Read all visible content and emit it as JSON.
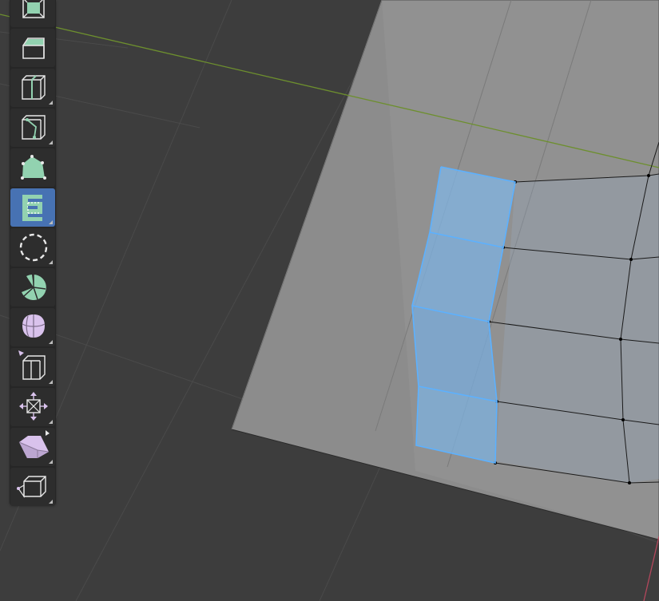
{
  "colors": {
    "background": "#3d3d3d",
    "mesh_plane": "#8e8e8e",
    "selection": "#7fb9ec",
    "selection_edge": "#5bb0ff",
    "axis_x": "#b3475c",
    "axis_y": "#6d8f2e",
    "toolbar": "#262626",
    "tool_active": "#4772b3",
    "mesh_icon": "#92d2b0",
    "transform_icon": "#d9c2ec"
  },
  "toolbar": {
    "tools": [
      {
        "name": "inset-faces",
        "icon": "inset-faces-icon",
        "active": false,
        "has_submenu": false
      },
      {
        "name": "bevel",
        "icon": "bevel-icon",
        "active": false,
        "has_submenu": false
      },
      {
        "name": "loop-cut",
        "icon": "loop-cut-icon",
        "active": false,
        "has_submenu": true
      },
      {
        "name": "knife",
        "icon": "knife-icon",
        "active": false,
        "has_submenu": true
      },
      {
        "name": "poly-build",
        "icon": "poly-build-icon",
        "active": false,
        "has_submenu": false
      },
      {
        "name": "extrude-region",
        "icon": "extrude-region-icon",
        "active": true,
        "has_submenu": true
      },
      {
        "name": "spin",
        "icon": "spin-icon",
        "active": false,
        "has_submenu": true
      },
      {
        "name": "smooth",
        "icon": "smooth-icon",
        "active": false,
        "has_submenu": false
      },
      {
        "name": "shrink-fatten",
        "icon": "shrink-fatten-icon",
        "active": false,
        "has_submenu": true
      },
      {
        "name": "edge-slide",
        "icon": "edge-slide-icon",
        "active": false,
        "has_submenu": true
      },
      {
        "name": "push-pull",
        "icon": "push-pull-icon",
        "active": false,
        "has_submenu": true
      },
      {
        "name": "shear",
        "icon": "shear-icon",
        "active": false,
        "has_submenu": true
      },
      {
        "name": "rip-region",
        "icon": "rip-region-icon",
        "active": false,
        "has_submenu": true
      }
    ]
  }
}
